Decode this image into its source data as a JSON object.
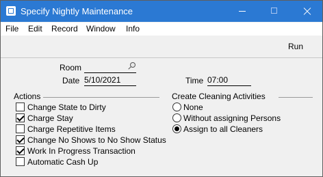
{
  "window": {
    "title": "Specify Nightly Maintenance"
  },
  "menu": [
    "File",
    "Edit",
    "Record",
    "Window",
    "Info"
  ],
  "toolbar": {
    "run_label": "Run"
  },
  "form": {
    "room_label": "Room",
    "room_value": "",
    "date_label": "Date",
    "date_value": "5/10/2021",
    "time_label": "Time",
    "time_value": "07:00"
  },
  "actions": {
    "title": "Actions",
    "items": [
      {
        "label": "Change State to Dirty",
        "checked": false
      },
      {
        "label": "Charge Stay",
        "checked": true
      },
      {
        "label": "Charge Repetitive Items",
        "checked": false
      },
      {
        "label": "Change No Shows to No Show Status",
        "checked": true
      },
      {
        "label": "Work In Progress Transaction",
        "checked": true
      },
      {
        "label": "Automatic Cash Up",
        "checked": false
      }
    ]
  },
  "cleaning": {
    "title": "Create Cleaning Activities",
    "options": [
      {
        "label": "None",
        "selected": false
      },
      {
        "label": "Without assigning Persons",
        "selected": false
      },
      {
        "label": "Assign to all Cleaners",
        "selected": true
      }
    ]
  }
}
